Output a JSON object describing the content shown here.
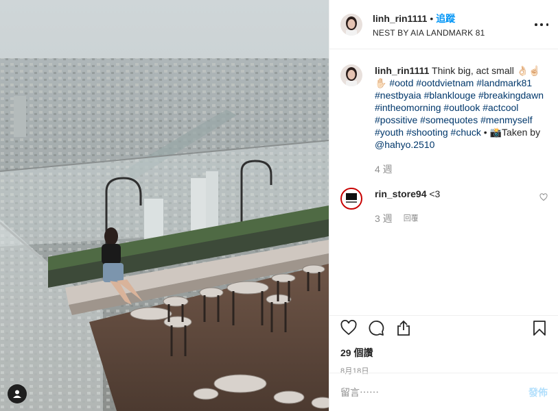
{
  "post": {
    "username": "linh_rin1111",
    "separator": "•",
    "follow_label": "追蹤",
    "location": "NEST BY AIA LANDMARK 81"
  },
  "caption": {
    "username": "linh_rin1111",
    "text": "Think big, act small",
    "emoji_1": "👌🏻☝🏻",
    "emoji_2": "✋🏻",
    "tags": [
      "#ootd",
      "#ootdvietnam",
      "#landmark81",
      "#nestbyaia",
      "#blanklouge",
      "#breakingdawn",
      "#intheomorning",
      "#outlook",
      "#actcool",
      "#possitive",
      "#somequotes",
      "#menmyself",
      "#youth",
      "#shooting",
      "#chuck"
    ],
    "bullet": "•",
    "camera_emoji": "📸",
    "taken_by": "Taken by",
    "mention": "@hahyo.2510",
    "age": "4 週"
  },
  "comment": {
    "username": "rin_store94",
    "text": "<3",
    "age": "3 週",
    "reply_label": "回覆"
  },
  "stats": {
    "likes": "29 個讚",
    "date": "8月18日"
  },
  "composer": {
    "placeholder": "留言⋯⋯",
    "post_label": "發佈"
  },
  "icons": [
    "more-icon",
    "heart-icon",
    "comment-icon",
    "share-icon",
    "bookmark-icon",
    "small-heart-icon",
    "profile-icon"
  ],
  "colors": {
    "accent": "#0095f6",
    "hashtag": "#00376b",
    "muted": "#8e8e8e",
    "post_disabled": "#b2dffc"
  }
}
